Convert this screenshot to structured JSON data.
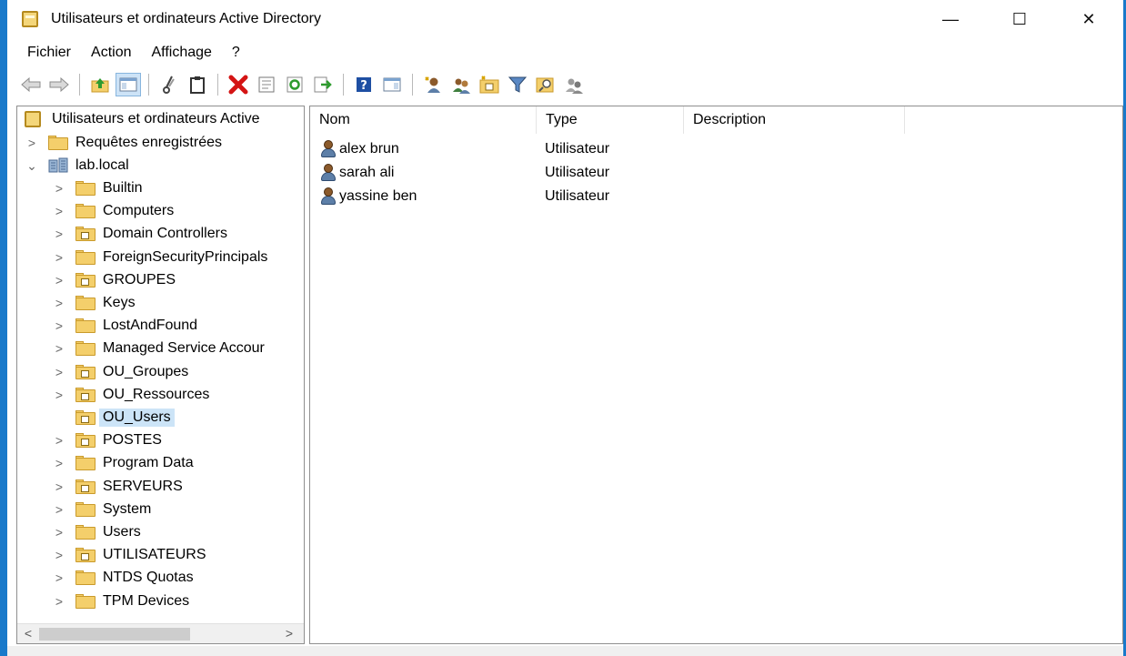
{
  "window": {
    "title": "Utilisateurs et ordinateurs Active Directory",
    "controls": {
      "minimize": "—",
      "maximize": "☐",
      "close": "✕"
    }
  },
  "menu": [
    "Fichier",
    "Action",
    "Affichage",
    "?"
  ],
  "toolbar": {
    "buttons": [
      "back-arrow",
      "forward-arrow",
      "folder-up",
      "show-hide-console-tree",
      "cut",
      "copy",
      "delete",
      "properties",
      "refresh",
      "export-list",
      "help",
      "show-hide-action-pane",
      "create-user",
      "create-group",
      "create-ou",
      "filter",
      "find",
      "add-to-group"
    ]
  },
  "tree": {
    "root": "Utilisateurs et ordinateurs Active",
    "saved_queries": "Requêtes enregistrées",
    "domain": "lab.local",
    "children": [
      {
        "label": "Builtin",
        "icon": "folder"
      },
      {
        "label": "Computers",
        "icon": "folder"
      },
      {
        "label": "Domain Controllers",
        "icon": "ou-folder"
      },
      {
        "label": "ForeignSecurityPrincipals",
        "icon": "folder"
      },
      {
        "label": "GROUPES",
        "icon": "ou-folder"
      },
      {
        "label": "Keys",
        "icon": "folder"
      },
      {
        "label": "LostAndFound",
        "icon": "folder"
      },
      {
        "label": "Managed Service Accour",
        "icon": "folder"
      },
      {
        "label": "OU_Groupes",
        "icon": "ou-folder"
      },
      {
        "label": "OU_Ressources",
        "icon": "ou-folder"
      },
      {
        "label": "OU_Users",
        "icon": "ou-folder",
        "selected": true
      },
      {
        "label": "POSTES",
        "icon": "ou-folder"
      },
      {
        "label": "Program Data",
        "icon": "folder"
      },
      {
        "label": "SERVEURS",
        "icon": "ou-folder"
      },
      {
        "label": "System",
        "icon": "folder"
      },
      {
        "label": "Users",
        "icon": "folder"
      },
      {
        "label": "UTILISATEURS",
        "icon": "ou-folder"
      },
      {
        "label": "NTDS Quotas",
        "icon": "folder"
      },
      {
        "label": "TPM Devices",
        "icon": "folder"
      }
    ]
  },
  "list": {
    "columns": [
      "Nom",
      "Type",
      "Description"
    ],
    "rows": [
      {
        "name": "alex brun",
        "type": "Utilisateur",
        "description": ""
      },
      {
        "name": "sarah ali",
        "type": "Utilisateur",
        "description": ""
      },
      {
        "name": "yassine ben",
        "type": "Utilisateur",
        "description": ""
      }
    ]
  },
  "scroll": {
    "left": "<",
    "right": ">"
  }
}
